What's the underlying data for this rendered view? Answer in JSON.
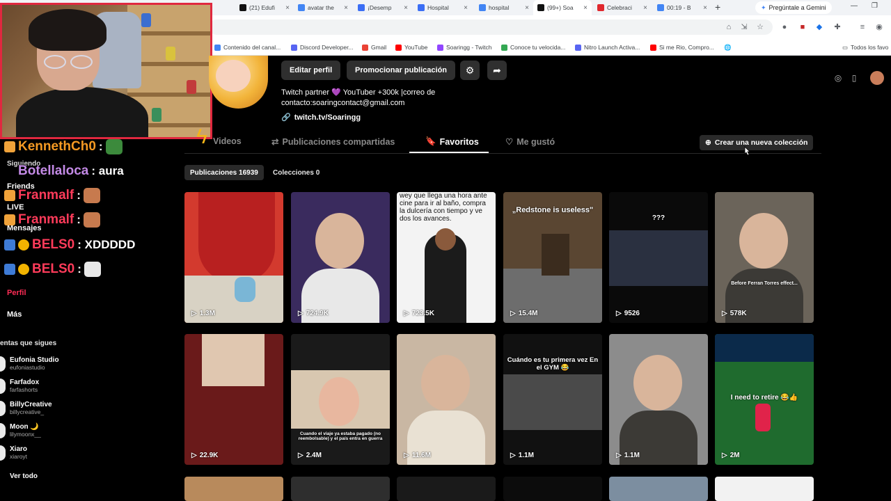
{
  "browser": {
    "tabs": [
      {
        "label": "(21) Edufi",
        "color": "#111111"
      },
      {
        "label": "avatar the",
        "color": "#4285f4"
      },
      {
        "label": "¡Desemp",
        "color": "#3b6ef5"
      },
      {
        "label": "Hospital",
        "color": "#3b6ef5"
      },
      {
        "label": "hospital",
        "color": "#4285f4"
      },
      {
        "label": "(99+) Soa",
        "color": "#111111"
      },
      {
        "label": "Celebraci",
        "color": "#e0282e"
      },
      {
        "label": "00:19 - B",
        "color": "#4285f4"
      }
    ],
    "gemini_label": "Pregúntale a Gemini",
    "bookmarks": [
      {
        "label": "Contenido del canal...",
        "color": "#4285f4"
      },
      {
        "label": "Discord Developer...",
        "color": "#5865f2"
      },
      {
        "label": "Gmail",
        "color": "#ea4335"
      },
      {
        "label": "YouTube",
        "color": "#ff0000"
      },
      {
        "label": "Soaringg - Twitch",
        "color": "#9146ff"
      },
      {
        "label": "Conoce tu velocida...",
        "color": "#34a853"
      },
      {
        "label": "Nitro Launch Activa...",
        "color": "#5865f2"
      },
      {
        "label": "Si me Rio, Compro...",
        "color": "#ff0000"
      }
    ],
    "all_favorites": "Todos los favo"
  },
  "chat": [
    {
      "user": "KennethCh0",
      "msg": ":",
      "color": "#f59a23"
    },
    {
      "user": "Botellaloca",
      "msg": ": aura",
      "color": "#c38ae6"
    },
    {
      "user": "Franmalf",
      "msg": ":",
      "color": "#ff3b5a"
    },
    {
      "user": "Franmalf",
      "msg": ":",
      "color": "#ff3b5a"
    },
    {
      "user": "BELS0",
      "msg": ": XDDDDD",
      "color": "#ff3b5a"
    },
    {
      "user": "BELS0",
      "msg": ":",
      "color": "#ff3b5a"
    }
  ],
  "sidebar": {
    "siguiendo": "Siguiendo",
    "friends": "Friends",
    "live": "LIVE",
    "mensajes": "Mensajes",
    "perfil": "Perfil",
    "mas": "Más",
    "accounts_header": "entas que sigues",
    "accounts": [
      {
        "name": "Eufonia Studio",
        "user": "eufoniastudio"
      },
      {
        "name": "Farfadox",
        "user": "farfashorts"
      },
      {
        "name": "BillyCreative",
        "user": "billycreative_"
      },
      {
        "name": "Moon 🌙",
        "user": "lilymoonx__"
      },
      {
        "name": "Xiaro",
        "user": "xiaroyt"
      }
    ],
    "ver_todo": "Ver todo"
  },
  "profile": {
    "edit_label": "Editar perfil",
    "promote_label": "Promocionar publicación",
    "bio_line1": "Twitch partner 💜 YouTuber +300k |correo de",
    "bio_line2": "contacto:soaringcontact@gmail.com",
    "link": "twitch.tv/Soaringg"
  },
  "tabs": {
    "videos": "Videos",
    "shared": "Publicaciones compartidas",
    "favorites": "Favoritos",
    "liked": "Me gustó",
    "new_collection": "Crear una nueva colección"
  },
  "subtabs": {
    "posts": "Publicaciones 16939",
    "collections": "Colecciones 0"
  },
  "videos": [
    {
      "views": "1.3M",
      "caption": "",
      "bg": "#d33a2e"
    },
    {
      "views": "724.9K",
      "caption": "",
      "bg": "#3a2b5e"
    },
    {
      "views": "723.5K",
      "caption": "wey que llega una hora ante cine para ir al baño, compra la dulcería con tiempo y ve dos los avances.",
      "bg": "#f3f3f3"
    },
    {
      "views": "15.4M",
      "caption": "„Redstone is useless\"",
      "bg": "#5a4632"
    },
    {
      "views": "9526",
      "caption": "???",
      "bg": "#0a0a0a"
    },
    {
      "views": "578K",
      "caption": "Before Ferran Torres effect...",
      "bg": "#6b645a"
    },
    {
      "views": "22.9K",
      "caption": "",
      "bg": "#6a1a1a"
    },
    {
      "views": "2.4M",
      "caption": "Cuando el viaje ya estaba pagado (no reembolsable) y el país entra en guerra",
      "bg": "#1a1a1a"
    },
    {
      "views": "11.6M",
      "caption": "",
      "bg": "#c9b7a3"
    },
    {
      "views": "1.1M",
      "caption": "Cuándo es tu primera vez En el GYM 😂",
      "bg": "#111111"
    },
    {
      "views": "1.1M",
      "caption": "",
      "bg": "#8c8c8c"
    },
    {
      "views": "2M",
      "caption": "I need to retire 😂👍",
      "bg": "#1f6b2e"
    }
  ]
}
